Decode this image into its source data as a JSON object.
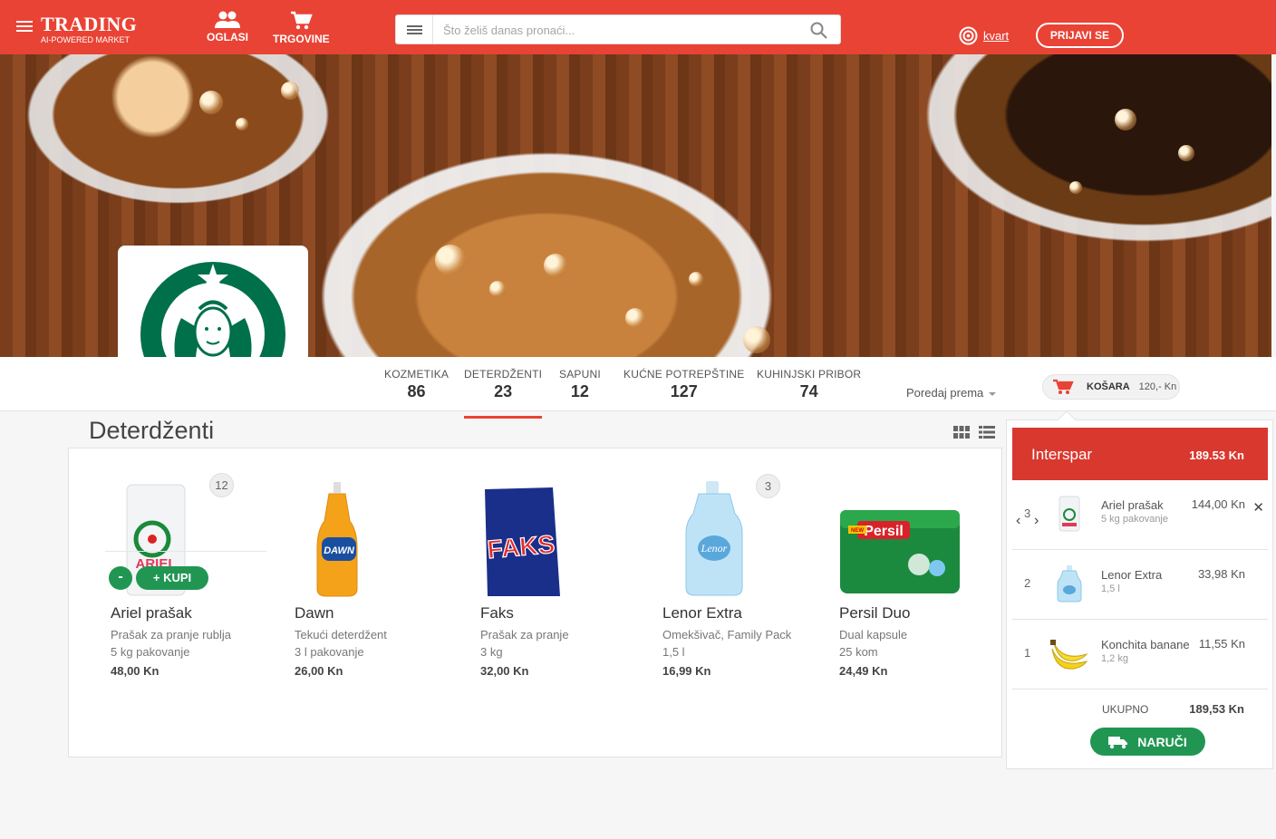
{
  "header": {
    "brand_title": "TRADING",
    "brand_subtitle": "AI-POWERED MARKET",
    "nav": [
      {
        "label": "OGLASI",
        "icon": "people-icon"
      },
      {
        "label": "TRGOVINE",
        "icon": "cart-icon"
      }
    ],
    "search": {
      "placeholder": "Što želiš danas pronaći..."
    },
    "location_label": "kvart",
    "login_label": "PRIJAVI SE",
    "colors": {
      "primary": "#e94335",
      "accent_green": "#219653"
    }
  },
  "categories": [
    {
      "name": "KOZMETIKA",
      "count": "86"
    },
    {
      "name": "DETERDŽENTI",
      "count": "23",
      "active": true
    },
    {
      "name": "SAPUNI",
      "count": "12"
    },
    {
      "name": "KUĆNE POTREPŠTINE",
      "count": "127"
    },
    {
      "name": "KUHINJSKI PRIBOR",
      "count": "74"
    }
  ],
  "sort_label": "Poredaj prema",
  "cart_button": {
    "label": "KOŠARA",
    "amount": "120,- Kn"
  },
  "page_title": "Deterdženti",
  "hover_actions": {
    "minus": "-",
    "buy": "KUPI"
  },
  "products": [
    {
      "name": "Ariel prašak",
      "desc1": "Prašak za pranje rublja",
      "desc2": "5 kg pakovanje",
      "price": "48,00 Kn",
      "badge": "12"
    },
    {
      "name": "Dawn",
      "desc1": "Tekući deterdžent",
      "desc2": "3 l pakovanje",
      "price": "26,00 Kn"
    },
    {
      "name": "Faks",
      "desc1": "Prašak za pranje",
      "desc2": "3 kg",
      "price": "32,00 Kn"
    },
    {
      "name": "Lenor Extra",
      "desc1": "Omekšivač, Family Pack",
      "desc2": "1,5 l",
      "price": "16,99 Kn",
      "badge": "3"
    },
    {
      "name": "Persil Duo",
      "desc1": "Dual kapsule",
      "desc2": "25 kom",
      "price": "24,49 Kn"
    }
  ],
  "product_labels": {
    "ariel": "ARIEL",
    "dawn": "DAWN",
    "faks": "FAKS",
    "lenor": "Lenor",
    "persil": "Persil",
    "persil_new": "NEW"
  },
  "cart_panel": {
    "store": "Interspar",
    "total": "189.53 Kn",
    "items": [
      {
        "qty": "3",
        "name": "Ariel prašak",
        "desc": "5 kg pakovanje",
        "price": "144,00  Kn"
      },
      {
        "qty": "2",
        "name": "Lenor Extra",
        "desc": "1,5 l",
        "price": "33,98 Kn"
      },
      {
        "qty": "1",
        "name": "Konchita banane",
        "desc": "1,2 kg",
        "price": "11,55 Kn"
      }
    ],
    "sum_label": "UKUPNO",
    "sum_value": "189,53 Kn",
    "order_label": "NARUČI"
  }
}
